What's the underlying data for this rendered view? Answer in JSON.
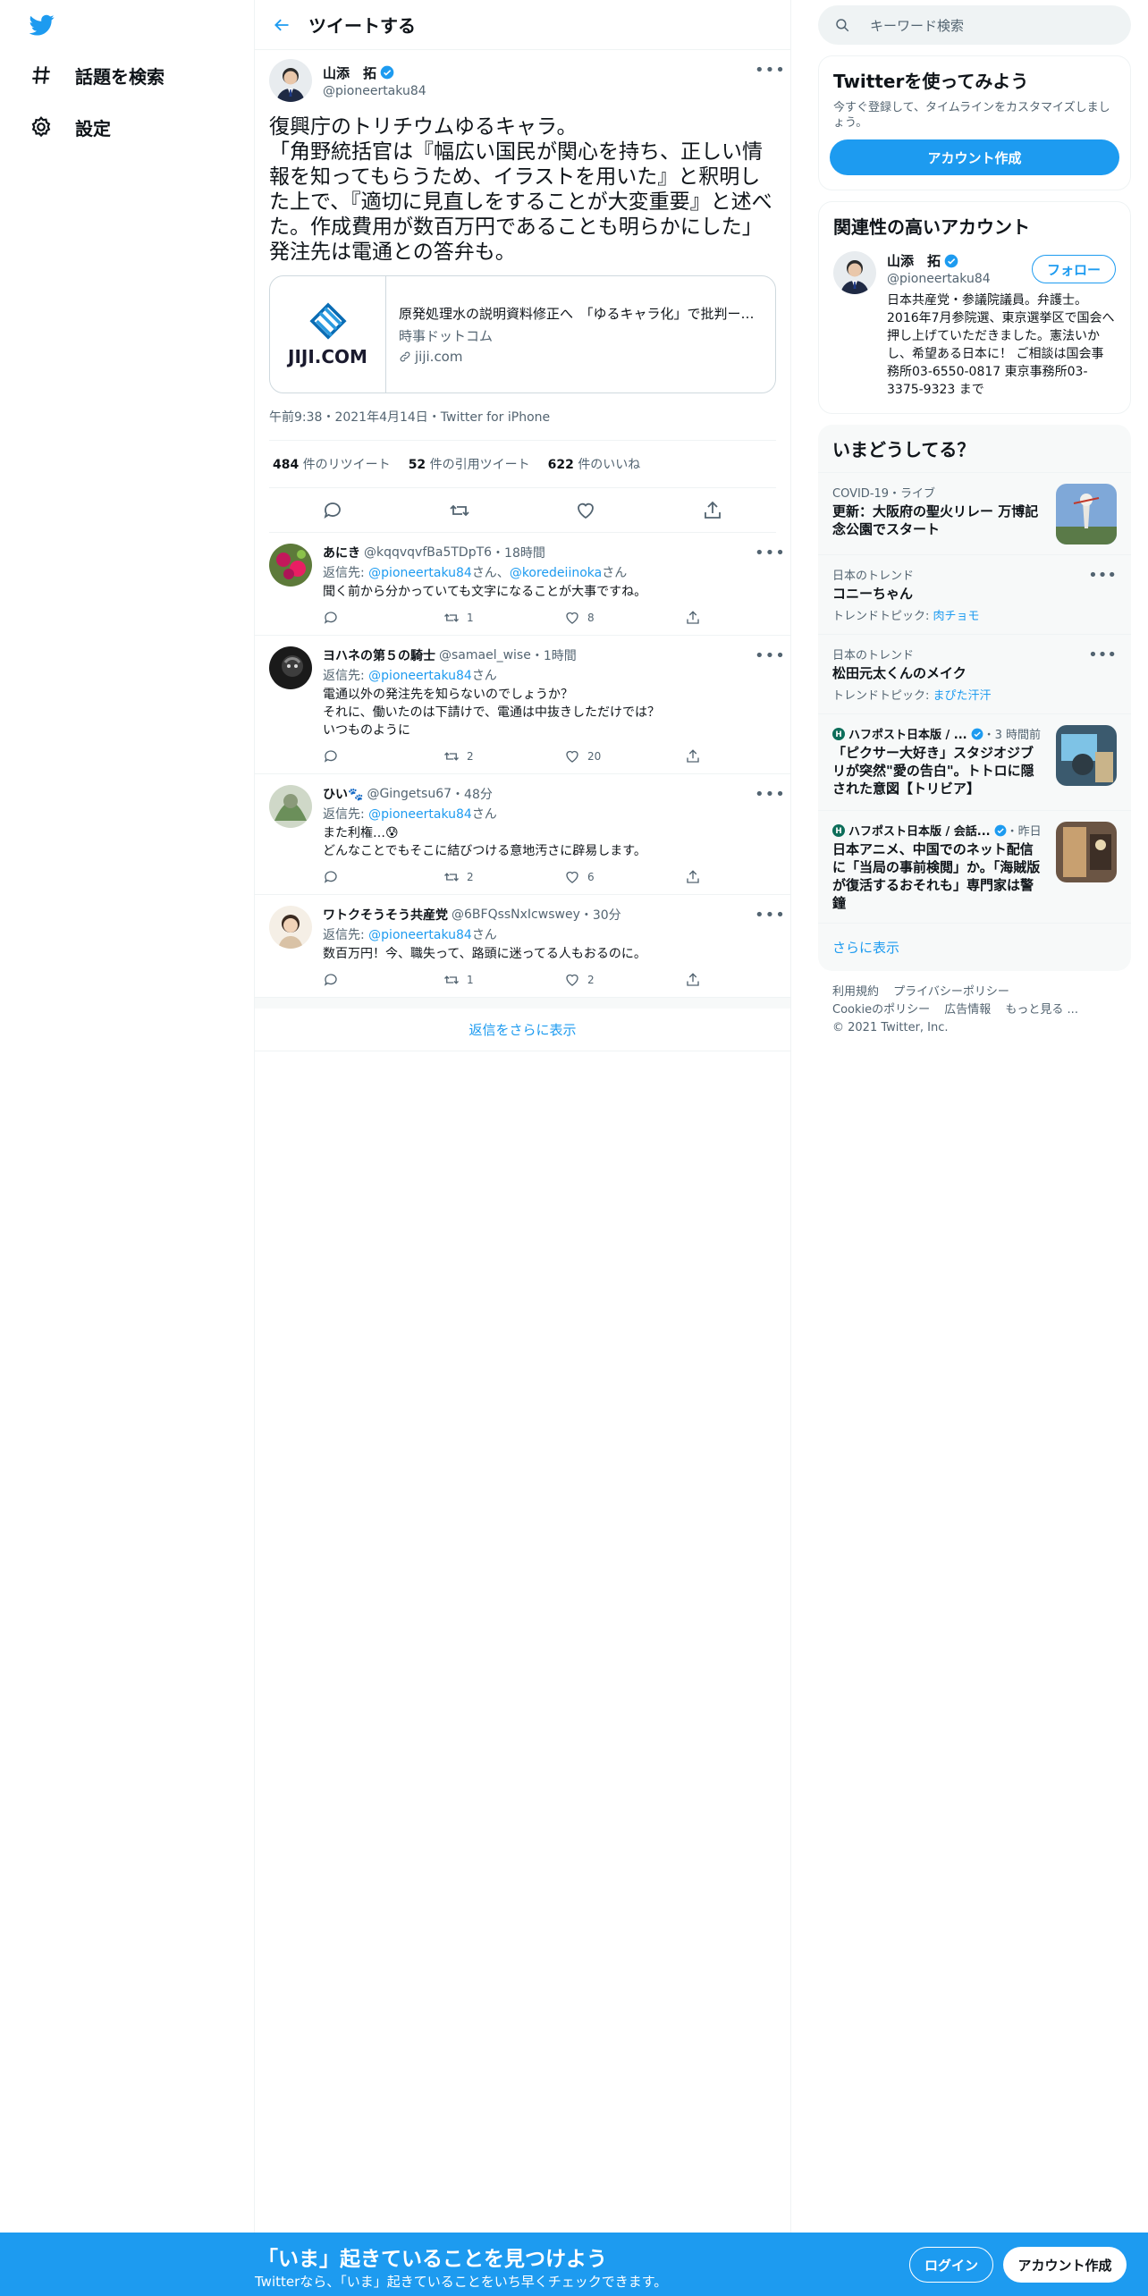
{
  "nav": {
    "items": [
      {
        "label": "話題を検索",
        "icon": "hashtag-icon"
      },
      {
        "label": "設定",
        "icon": "gear-icon"
      }
    ]
  },
  "header": {
    "title": "ツイートする"
  },
  "tweet": {
    "author_name": "山添　拓",
    "author_handle": "@pioneertaku84",
    "text": "復興庁のトリチウムゆるキャラ。\n「角野統括官は『幅広い国民が関心を持ち、正しい情報を知ってもらうため、イラストを用いた』と釈明した上で、『適切に見直しをすることが大変重要』と述べた。作成費用が数百万円であることも明らかにした」\n発注先は電通との答弁も。",
    "card": {
      "logo_text": "JIJI.COM",
      "title": "原発処理水の説明資料修正へ　「ゆるキャラ化」で批判ー…",
      "source": "時事ドットコム",
      "domain": "jiji.com"
    },
    "meta": "午前9:38・2021年4月14日・Twitter for iPhone",
    "retweets": "484",
    "retweets_label": "件のリツイート",
    "quotes": "52",
    "quotes_label": "件の引用ツイート",
    "likes": "622",
    "likes_label": "件のいいね"
  },
  "replies": [
    {
      "name": "あにき",
      "handle": "@kqqvqvfBa5TDpT6",
      "time": "・18時間",
      "reply_prefix": "返信先: ",
      "reply_to": "@pioneertaku84",
      "reply_suffix": "さん、",
      "reply_to2": "@koredeiinoka",
      "reply_suffix2": "さん",
      "text": "聞く前から分かっていても文字になることが大事ですね。",
      "retweets": "1",
      "likes": "8"
    },
    {
      "name": "ヨハネの第５の騎士",
      "handle": "@samael_wise",
      "time": "・1時間",
      "reply_prefix": "返信先: ",
      "reply_to": "@pioneertaku84",
      "reply_suffix": "さん",
      "text": "電通以外の発注先を知らないのでしょうか？\nそれに、働いたのは下請けで、電通は中抜きしただけでは？\nいつものように",
      "retweets": "2",
      "likes": "20"
    },
    {
      "name": "ひい🐾",
      "handle": "@Gingetsu67",
      "time": "・48分",
      "reply_prefix": "返信先: ",
      "reply_to": "@pioneertaku84",
      "reply_suffix": "さん",
      "text": "また利権…😰\nどんなことでもそこに結びつける意地汚さに辟易します。",
      "retweets": "2",
      "likes": "6"
    },
    {
      "name": "ワトクそうそう共産党",
      "handle": "@6BFQssNxIcwswey",
      "time": "・30分",
      "reply_prefix": "返信先: ",
      "reply_to": "@pioneertaku84",
      "reply_suffix": "さん",
      "text": "数百万円！今、職失って、路頭に迷ってる人もおるのに。",
      "retweets": "1",
      "likes": "2"
    }
  ],
  "show_more": "返信をさらに表示",
  "right": {
    "search_placeholder": "キーワード検索",
    "signup": {
      "title": "Twitterを使ってみよう",
      "desc": "今すぐ登録して、タイムラインをカスタマイズしましょう。",
      "button": "アカウント作成"
    },
    "related": {
      "title": "関連性の高いアカウント",
      "name": "山添　拓",
      "handle": "@pioneertaku84",
      "follow": "フォロー",
      "bio": "日本共産党・参議院議員。弁護士。2016年7月参院選、東京選挙区で国会へ押し上げていただきました。憲法いかし、希望ある日本に！ ご相談は国会事務所03-6550-0817 東京事務所03-3375-9323 まで"
    },
    "trends": {
      "title": "いまどうしてる？",
      "items": [
        {
          "context": "COVID-19・ライブ",
          "title": "更新：大阪府の聖火リレー 万博記念公園でスタート",
          "topic": "",
          "topic_link": ""
        },
        {
          "context": "日本のトレンド",
          "title": "コニーちゃん",
          "topic": "トレンドトピック: ",
          "topic_link": "肉チョモ"
        },
        {
          "context": "日本のトレンド",
          "title": "松田元太くんのメイク",
          "topic": "トレンドトピック: ",
          "topic_link": "まぴた汗汗"
        },
        {
          "context": "ハフポスト日本版 / ...",
          "context_time": "・3 時間前",
          "title": "「ピクサー大好き」スタジオジブリが突然\"愛の告白\"。トトロに隠された意図【トリビア】",
          "topic": "",
          "topic_link": ""
        },
        {
          "context": "ハフポスト日本版 / 会話...",
          "context_time": "・昨日",
          "title": "日本アニメ、中国でのネット配信に「当局の事前検閲」か。「海賊版が復活するおそれも」専門家は警鐘",
          "topic": "",
          "topic_link": ""
        }
      ],
      "more": "さらに表示"
    },
    "footer": {
      "links": [
        "利用規約",
        "プライバシーポリシー",
        "Cookieのポリシー",
        "広告情報",
        "もっと見る ..."
      ],
      "copyright": "© 2021 Twitter, Inc."
    }
  },
  "bottom": {
    "headline": "「いま」起きていることを見つけよう",
    "sub": "Twitterなら、「いま」起きていることをいち早くチェックできます。",
    "login": "ログイン",
    "signup": "アカウント作成"
  },
  "colors": {
    "accent": "#1d9bf0",
    "text": "#0f1419",
    "muted": "#536471",
    "border": "#eff3f4"
  }
}
